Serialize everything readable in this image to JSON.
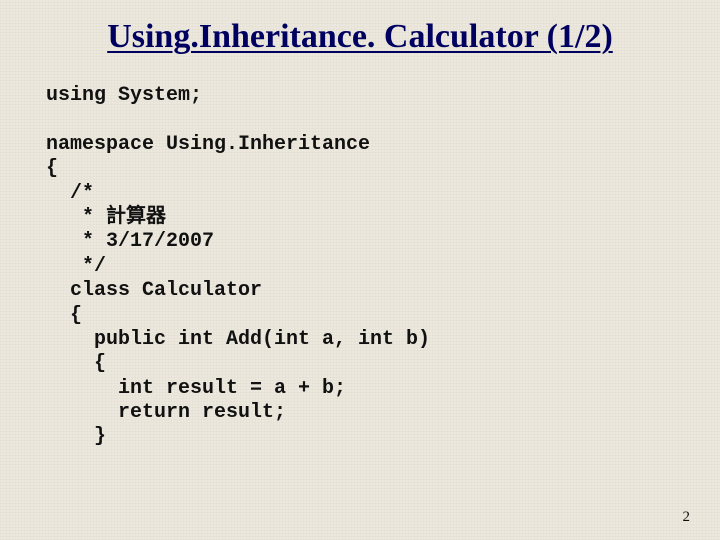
{
  "slide": {
    "title": "Using.Inheritance. Calculator (1/2)",
    "page_number": "2"
  },
  "code": {
    "l1": "using System;",
    "l2": "",
    "l3": "namespace Using.Inheritance",
    "l4": "{",
    "l5": "  /*",
    "l6": "   * 計算器",
    "l7": "   * 3/17/2007",
    "l8": "   */",
    "l9": "  class Calculator",
    "l10": "  {",
    "l11": "    public int Add(int a, int b)",
    "l12": "    {",
    "l13": "      int result = a + b;",
    "l14": "      return result;",
    "l15": "    }"
  }
}
